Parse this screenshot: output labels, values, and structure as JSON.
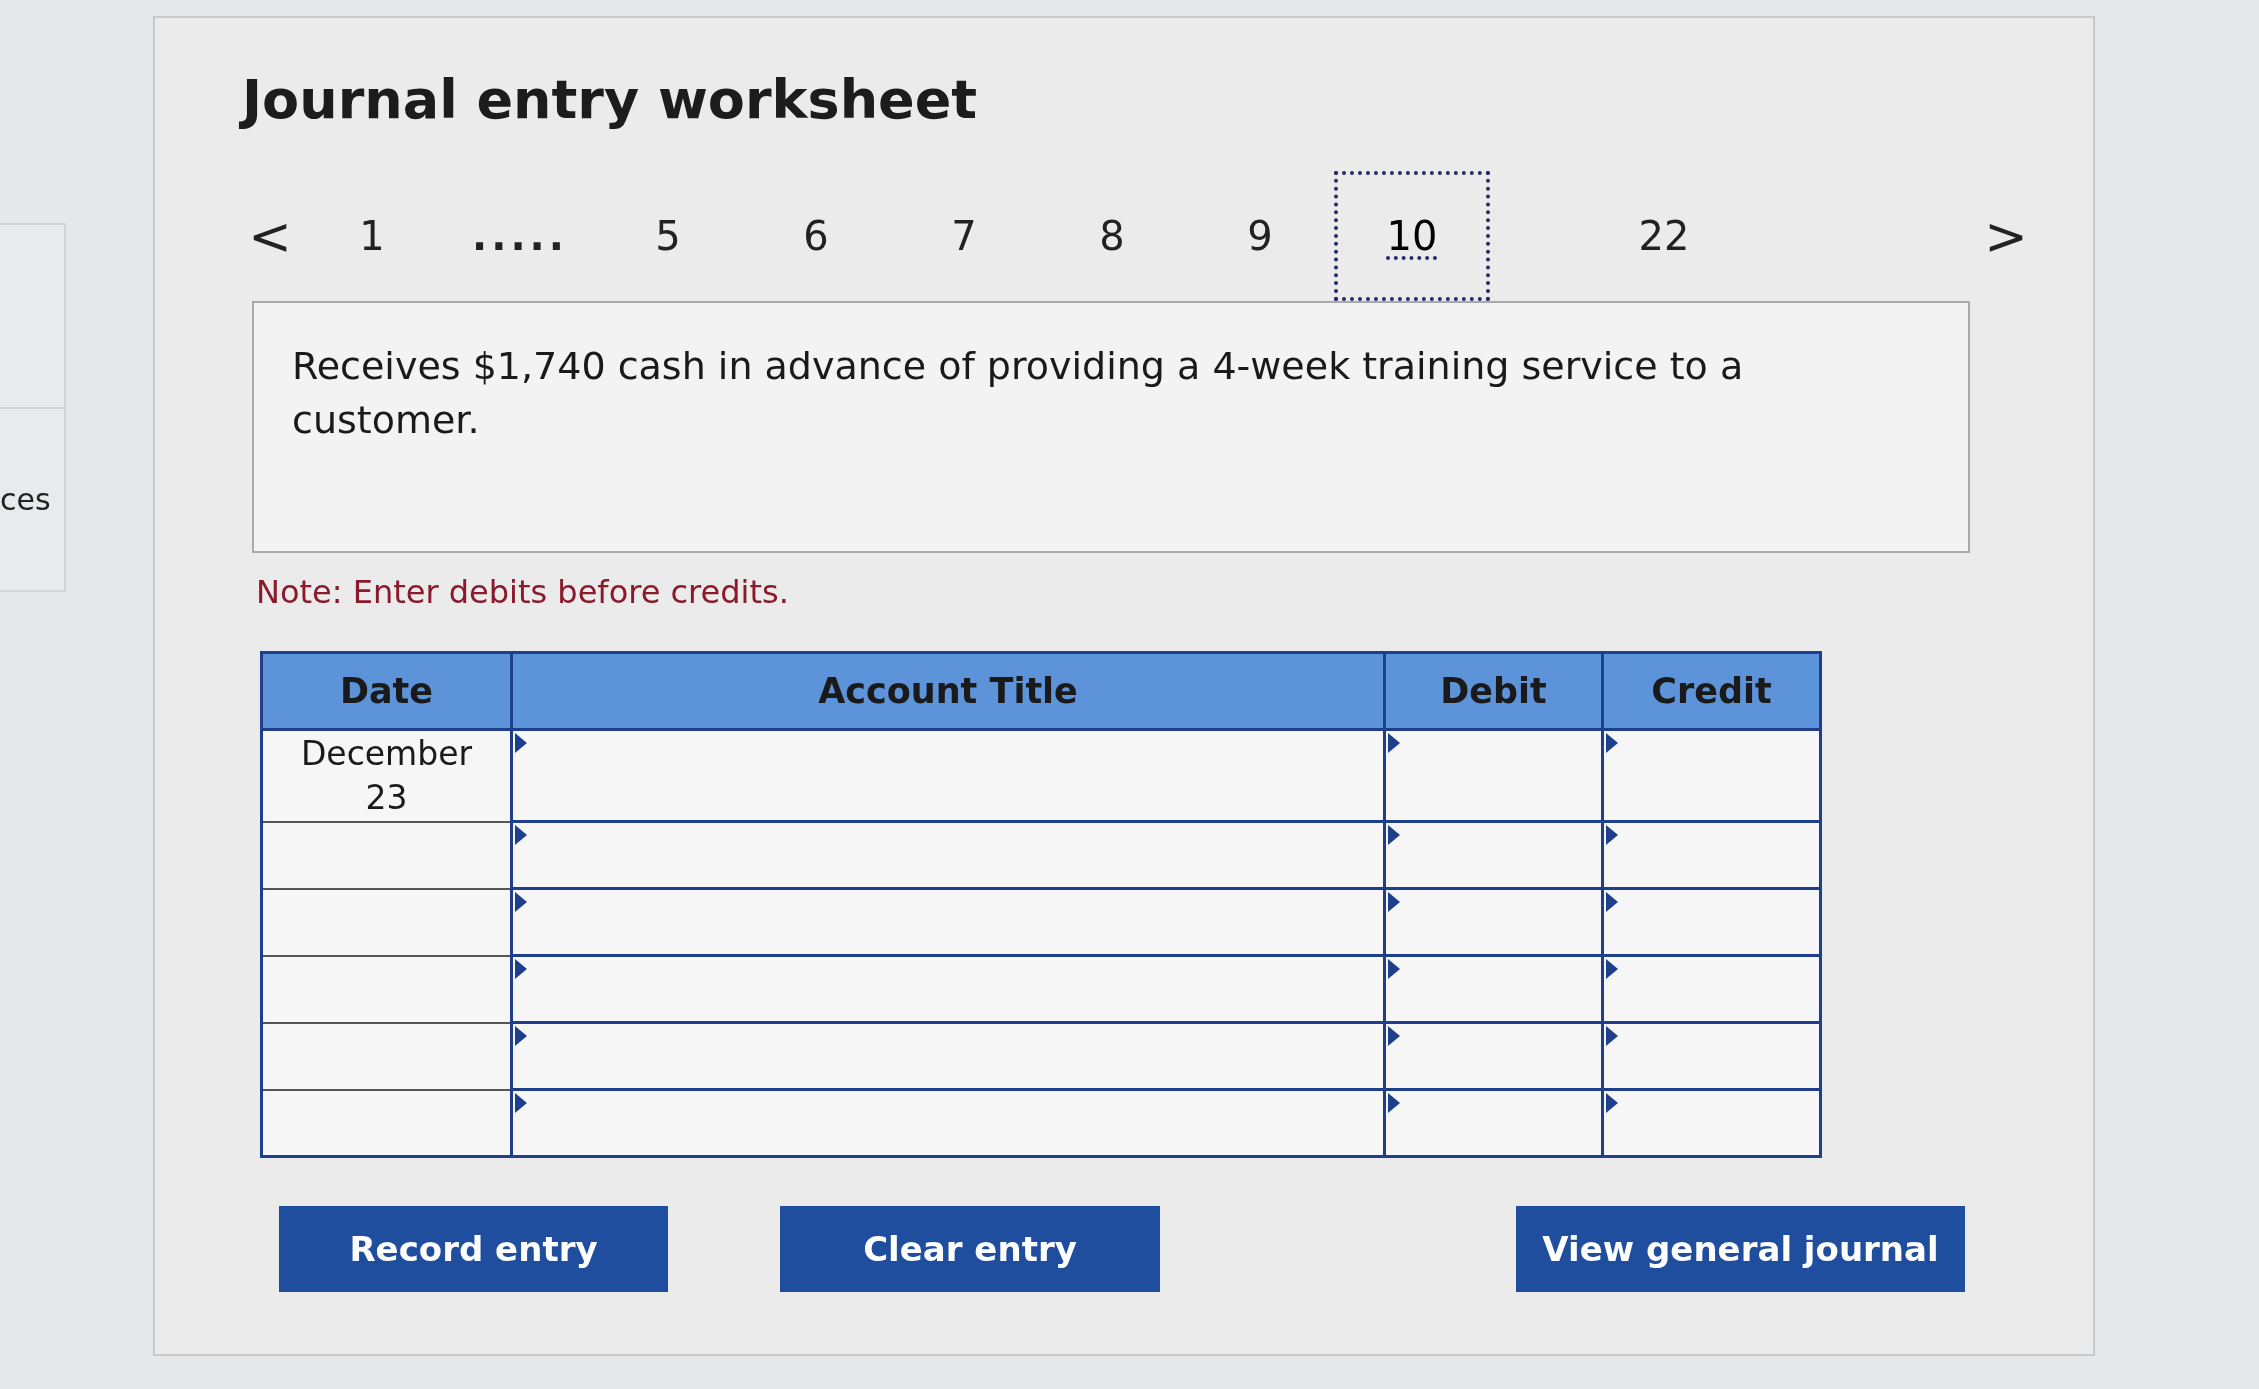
{
  "side_panel": {
    "label": "ces"
  },
  "title": "Journal entry worksheet",
  "pagination": {
    "prev": "<",
    "next": ">",
    "items": [
      {
        "kind": "page",
        "label": "1",
        "selected": false
      },
      {
        "kind": "gap",
        "label": "....."
      },
      {
        "kind": "page",
        "label": "5",
        "selected": false
      },
      {
        "kind": "page",
        "label": "6",
        "selected": false
      },
      {
        "kind": "page",
        "label": "7",
        "selected": false
      },
      {
        "kind": "page",
        "label": "8",
        "selected": false
      },
      {
        "kind": "page",
        "label": "9",
        "selected": false
      },
      {
        "kind": "page",
        "label": "10",
        "selected": true
      },
      {
        "kind": "page",
        "label": "22",
        "selected": false
      }
    ]
  },
  "question": "Receives $1,740 cash in advance of providing a 4-week training service to a customer.",
  "note": "Note: Enter debits before credits.",
  "table": {
    "columns": [
      "Date",
      "Account Title",
      "Debit",
      "Credit"
    ],
    "rows": [
      {
        "date": "December 23"
      },
      {
        "date": ""
      },
      {
        "date": ""
      },
      {
        "date": ""
      },
      {
        "date": ""
      },
      {
        "date": ""
      }
    ]
  },
  "buttons": [
    "Record entry",
    "Clear entry",
    "View general journal"
  ]
}
